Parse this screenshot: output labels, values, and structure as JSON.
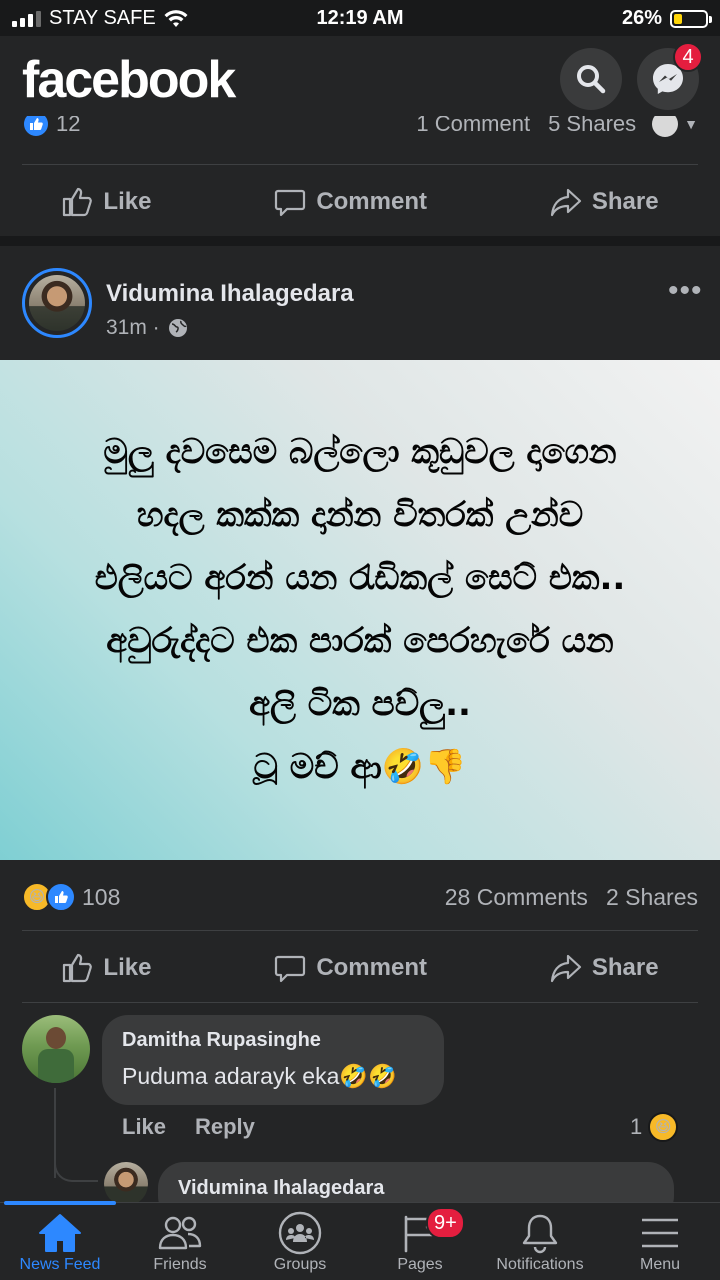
{
  "status_bar": {
    "carrier": "STAY SAFE",
    "time": "12:19 AM",
    "battery": "26%",
    "battery_level": 0.26
  },
  "header": {
    "logo": "facebook",
    "messenger_badge": "4"
  },
  "post_prev": {
    "likes": "12",
    "comments": "1 Comment",
    "shares": "5 Shares"
  },
  "actions": {
    "like": "Like",
    "comment": "Comment",
    "share": "Share"
  },
  "post": {
    "author": "Vidumina Ihalagedara",
    "time": "31m ·",
    "text_lines": [
      "මුලු දවසෙම බල්ලො කූඩුවල දාගෙන",
      "හදල කක්ක දාන්න විතරක් උන්ව",
      "එලියට අරන් යන රැඩිකල් සෙට් එක..",
      "අවුරුද්දට එක පාරක් පෙරහැරේ යන",
      "අලි ටික පව්ලු..",
      "ටූ මච් ආ🤣👎"
    ],
    "reactions_count": "108",
    "comments": "28 Comments",
    "shares": "2 Shares"
  },
  "comment": {
    "author": "Damitha Rupasinghe",
    "text": "Puduma adarayk eka🤣🤣",
    "like": "Like",
    "reply": "Reply",
    "reaction_count": "1"
  },
  "reply": {
    "author": "Vidumina Ihalagedara"
  },
  "nav": {
    "news_feed": "News Feed",
    "friends": "Friends",
    "groups": "Groups",
    "pages": "Pages",
    "pages_badge": "9+",
    "notifications": "Notifications",
    "menu": "Menu"
  },
  "colors": {
    "accent": "#2d88ff",
    "badge": "#e41e3f",
    "background": "#18191a",
    "surface": "#242526"
  }
}
